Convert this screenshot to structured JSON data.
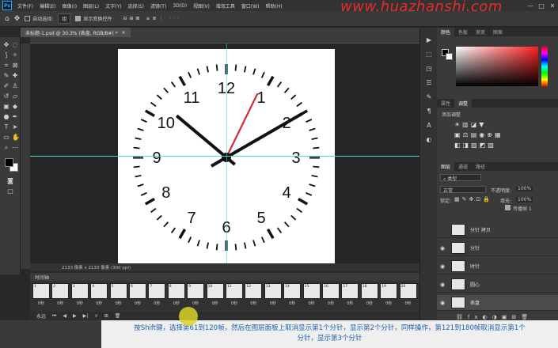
{
  "app": {
    "logo": "Ps"
  },
  "menu": [
    "文件(F)",
    "编辑(E)",
    "图像(I)",
    "图层(L)",
    "文字(Y)",
    "选择(S)",
    "滤镜(T)",
    "3D(D)",
    "视图(V)",
    "增效工具",
    "窗口(W)",
    "帮助(H)"
  ],
  "window_buttons": [
    "—",
    "□",
    "✕"
  ],
  "watermark": "www.huazhanshi.com",
  "options": {
    "auto_select_label": "自动选择:",
    "auto_select_value": "组",
    "show_transform_label": "显示变换控件"
  },
  "document": {
    "tab_title": "未标题-1.psd @ 30.3% (表盘, RGB/8#) *"
  },
  "clock": {
    "numbers": [
      "12",
      "1",
      "2",
      "3",
      "4",
      "5",
      "6",
      "7",
      "8",
      "9",
      "10",
      "11"
    ]
  },
  "status": {
    "text": "2133 像素 x 2133 像素 (300 ppi)"
  },
  "timeline": {
    "title": "时间轴",
    "frames": [
      {
        "num": "1",
        "dur": "0秒"
      },
      {
        "num": "2",
        "dur": "0秒"
      },
      {
        "num": "3",
        "dur": "0秒"
      },
      {
        "num": "4",
        "dur": "0秒"
      },
      {
        "num": "5",
        "dur": "0秒"
      },
      {
        "num": "6",
        "dur": "0秒"
      },
      {
        "num": "7",
        "dur": "0秒"
      },
      {
        "num": "8",
        "dur": "0秒"
      },
      {
        "num": "9",
        "dur": "0秒"
      },
      {
        "num": "10",
        "dur": "0秒"
      },
      {
        "num": "11",
        "dur": "0秒"
      },
      {
        "num": "12",
        "dur": "0秒"
      },
      {
        "num": "13",
        "dur": "0秒"
      },
      {
        "num": "14",
        "dur": "0秒"
      },
      {
        "num": "15",
        "dur": "0秒"
      },
      {
        "num": "16",
        "dur": "0秒"
      },
      {
        "num": "17",
        "dur": "0秒"
      },
      {
        "num": "18",
        "dur": "0秒"
      },
      {
        "num": "19",
        "dur": "0秒"
      },
      {
        "num": "20",
        "dur": "0秒"
      }
    ],
    "loop_label": "永远"
  },
  "panels": {
    "color_tabs": [
      "颜色",
      "色板",
      "渐变",
      "图案"
    ],
    "adjust_tabs": [
      "属性",
      "调整"
    ],
    "adjust_title": "添加调整",
    "layer_tabs": [
      "图层",
      "通道",
      "路径"
    ],
    "kind_label": "类型",
    "blend_mode": "正常",
    "opacity_label": "不透明度:",
    "opacity_value": "100%",
    "lock_label": "锁定:",
    "fill_label": "填充:",
    "fill_value": "100%",
    "propagate_label": "传播帧 1",
    "layers": [
      {
        "name": "分针 拷贝"
      },
      {
        "name": "分针"
      },
      {
        "name": "时针"
      },
      {
        "name": "圆心"
      },
      {
        "name": "表盘"
      }
    ]
  },
  "subtitle": {
    "line1": "按Shift键，选择第61到120帧，然后在图层面板上取消显示第1个分针，显示第2个分针，同样操作，第121到180帧取消显示第1个",
    "line2": "分针，显示第3个分针"
  },
  "colors": {
    "second_hand": "#d42a35",
    "guide": "#4fd6d6",
    "subtitle_text": "#1a5fb4"
  }
}
